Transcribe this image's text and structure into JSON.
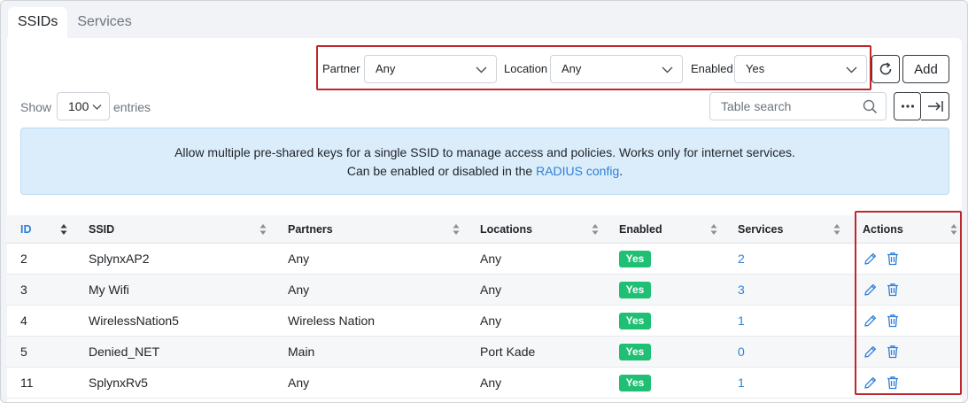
{
  "tabs": [
    {
      "label": "SSIDs",
      "active": true
    },
    {
      "label": "Services",
      "active": false
    }
  ],
  "filters": {
    "partner": {
      "label": "Partner",
      "value": "Any"
    },
    "location": {
      "label": "Location",
      "value": "Any"
    },
    "enabled": {
      "label": "Enabled",
      "value": "Yes"
    }
  },
  "toolbar": {
    "add_label": "Add",
    "refresh_icon": "refresh-icon",
    "more_icon": "more-icon",
    "export_icon": "arrow-right-bar-icon"
  },
  "length": {
    "show": "Show",
    "value": "100",
    "entries": "entries"
  },
  "search": {
    "placeholder": "Table search"
  },
  "info": {
    "line1": "Allow multiple pre-shared keys for a single SSID to manage access and policies. Works only for internet services.",
    "line2_prefix": "Can be enabled or disabled in the ",
    "link": "RADIUS config",
    "line2_suffix": "."
  },
  "table": {
    "headers": {
      "id": "ID",
      "ssid": "SSID",
      "partners": "Partners",
      "locations": "Locations",
      "enabled": "Enabled",
      "services": "Services",
      "actions": "Actions"
    },
    "rows": [
      {
        "id": "2",
        "ssid": "SplynxAP2",
        "partners": "Any",
        "locations": "Any",
        "enabled": "Yes",
        "services": "2"
      },
      {
        "id": "3",
        "ssid": "My Wifi",
        "partners": "Any",
        "locations": "Any",
        "enabled": "Yes",
        "services": "3"
      },
      {
        "id": "4",
        "ssid": "WirelessNation5",
        "partners": "Wireless Nation",
        "locations": "Any",
        "enabled": "Yes",
        "services": "1"
      },
      {
        "id": "5",
        "ssid": "Denied_NET",
        "partners": "Main",
        "locations": "Port Kade",
        "enabled": "Yes",
        "services": "0"
      },
      {
        "id": "11",
        "ssid": "SplynxRv5",
        "partners": "Any",
        "locations": "Any",
        "enabled": "Yes",
        "services": "1"
      }
    ]
  },
  "colors": {
    "accent": "#2f7fd8",
    "badge": "#1fbf74",
    "highlight": "#c0282d",
    "info_bg": "#dbedfb"
  }
}
